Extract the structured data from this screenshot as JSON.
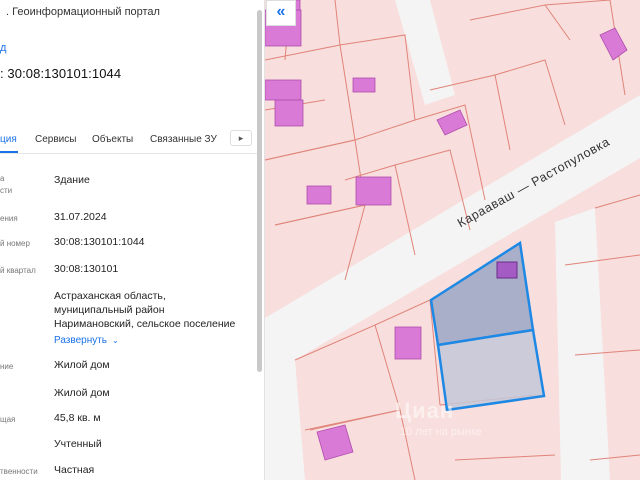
{
  "header": {
    "title": ". Геоинформационный портал",
    "back_link": "д",
    "object_title": ": 30:08:130101:1044"
  },
  "tabs": [
    {
      "label": "ция",
      "active": true
    },
    {
      "label": "Сервисы",
      "active": false
    },
    {
      "label": "Объекты",
      "active": false
    },
    {
      "label": "Связанные ЗУ",
      "active": false
    }
  ],
  "tabs_more_icon": "chevron-right-icon",
  "details": [
    {
      "label": "а\nсти",
      "value": "Здание"
    },
    {
      "label": "ения",
      "value": "31.07.2024"
    },
    {
      "label": "й номер",
      "value": "30:08:130101:1044"
    },
    {
      "label": "й квартал",
      "value": "30:08:130101"
    },
    {
      "label": "",
      "value": "Астраханская область,\nмуниципальный район\nНаримановский, сельское поселение"
    },
    {
      "label": "ние",
      "value": "Жилой дом"
    },
    {
      "label": "",
      "value": "Жилой дом"
    },
    {
      "label": "щая",
      "value": "45,8 кв. м"
    },
    {
      "label": "",
      "value": "Учтенный"
    },
    {
      "label": "твенности",
      "value": "Частная"
    }
  ],
  "expand_label": "Развернуть",
  "map": {
    "street_label": "Карааваш — Растопуловка",
    "collapse_icon": "double-chevron-left-icon",
    "watermark": "Циан",
    "watermark_sub": "10 лет на рынке",
    "colors": {
      "background": "#f8dedc",
      "road": "#f3f3f3",
      "parcel_border": "#e0847a",
      "building": "#d97ad6",
      "selection": "#1e88e5"
    }
  }
}
